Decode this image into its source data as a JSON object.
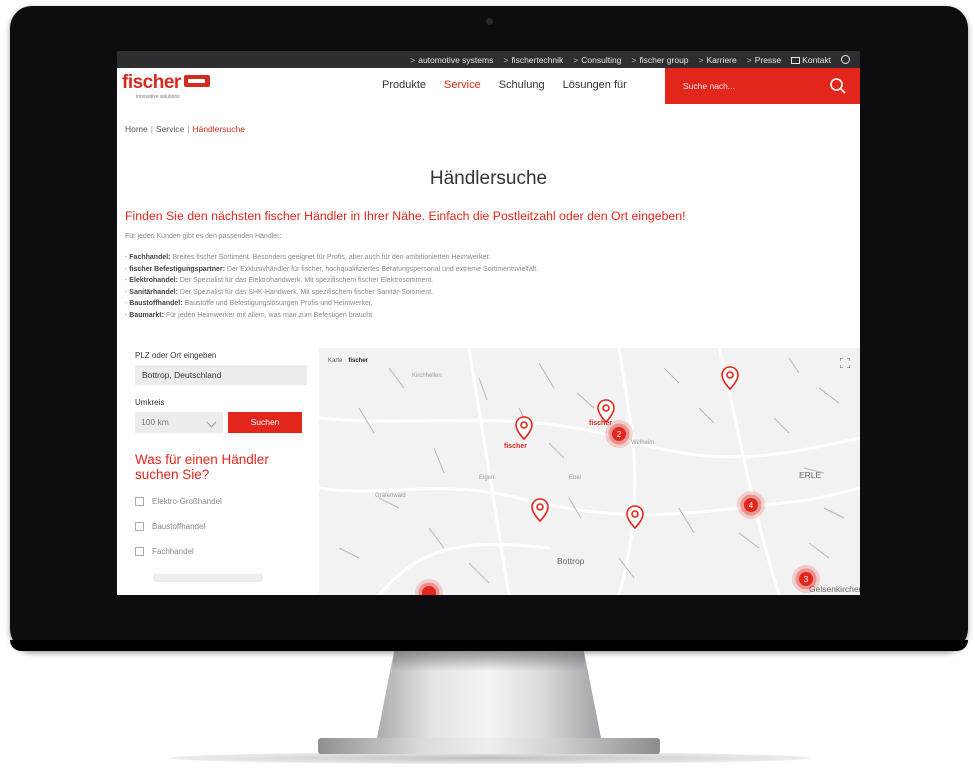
{
  "topbar": {
    "links": [
      {
        "label": "automotive systems"
      },
      {
        "label": "fischertechnik"
      },
      {
        "label": "Consulting"
      },
      {
        "label": "fischer group"
      },
      {
        "label": "Karriere"
      },
      {
        "label": "Presse"
      }
    ],
    "contact_label": "Kontakt",
    "globe_icon": "globe-icon",
    "mail_icon": "mail-icon"
  },
  "header": {
    "logo_text": "fischer",
    "logo_sub": "innovative solutions",
    "nav": [
      {
        "label": "Produkte",
        "active": false
      },
      {
        "label": "Service",
        "active": true
      },
      {
        "label": "Schulung",
        "active": false
      },
      {
        "label": "Lösungen für",
        "active": false
      }
    ],
    "search_placeholder": "Suche nach...",
    "search_icon": "search-icon"
  },
  "breadcrumb": {
    "home": "Home",
    "service": "Service",
    "current": "Händlersuche"
  },
  "page": {
    "title": "Händlersuche",
    "lead": "Finden Sie den nächsten fischer Händler in Ihrer Nähe. Einfach die Postleitzahl oder den Ort eingeben!",
    "intro": "Für jeden Kunden gibt es den passenden Händler:",
    "types": [
      {
        "name": "Fachhandel:",
        "desc": "Breites fischer Sortiment. Besonders geeignet für Profis, aber auch für den ambitionierten Heimwerker."
      },
      {
        "name": "fischer Befestigungspartner:",
        "desc": "Der Exklusivhändler für fischer, hochqualifiziertes Beratungspersonal und extreme Sortimentsvielfalt."
      },
      {
        "name": "Elektrohandel:",
        "desc": "Der Spezialist für das Elektrohandwerk. Mit spezifischem fischer Elektrosortiment."
      },
      {
        "name": "Sanitärhandel:",
        "desc": "Der Spezialist für das SHK-Handwerk. Mit spezifischem fischer Sanitär-Sortiment."
      },
      {
        "name": "Baustoffhandel:",
        "desc": "Baustoffe und Befestigungslösungen Profis und Heimwerker."
      },
      {
        "name": "Baumarkt:",
        "desc": "Für jeden Heimwerker mit allem, was man zum Befestigen braucht."
      }
    ]
  },
  "form": {
    "plz_label": "PLZ oder Ort eingeben",
    "plz_value": "Bottrop, Deutschland",
    "umkreis_label": "Umkreis",
    "umkreis_value": "100 km",
    "submit_label": "Suchen",
    "filter_title": "Was für einen Händler suchen Sie?",
    "filters": [
      {
        "label": "Elektro-Großhandel"
      },
      {
        "label": "Baustoffhandel"
      },
      {
        "label": "Fachhandel"
      }
    ]
  },
  "map": {
    "tabs": [
      {
        "label": "Karte",
        "active": false
      },
      {
        "label": "fischer",
        "active": true
      }
    ],
    "labels": {
      "bottrop": "Bottrop",
      "erle": "ERLE",
      "welheim": "Welheim",
      "kirchen": "Gelsenkirchen",
      "feldhausen": "Kirchhellen",
      "grafenwald": "Grafenwald",
      "eigen": "Eigen",
      "ebel": "Ebel"
    },
    "clusters": [
      {
        "count": "2"
      },
      {
        "count": "4"
      },
      {
        "count": "3"
      }
    ],
    "dealer_logo": "fischer",
    "accent": "#e3261c"
  },
  "colors": {
    "brand_red": "#e3261c",
    "topbar_bg": "#2e2e31"
  }
}
